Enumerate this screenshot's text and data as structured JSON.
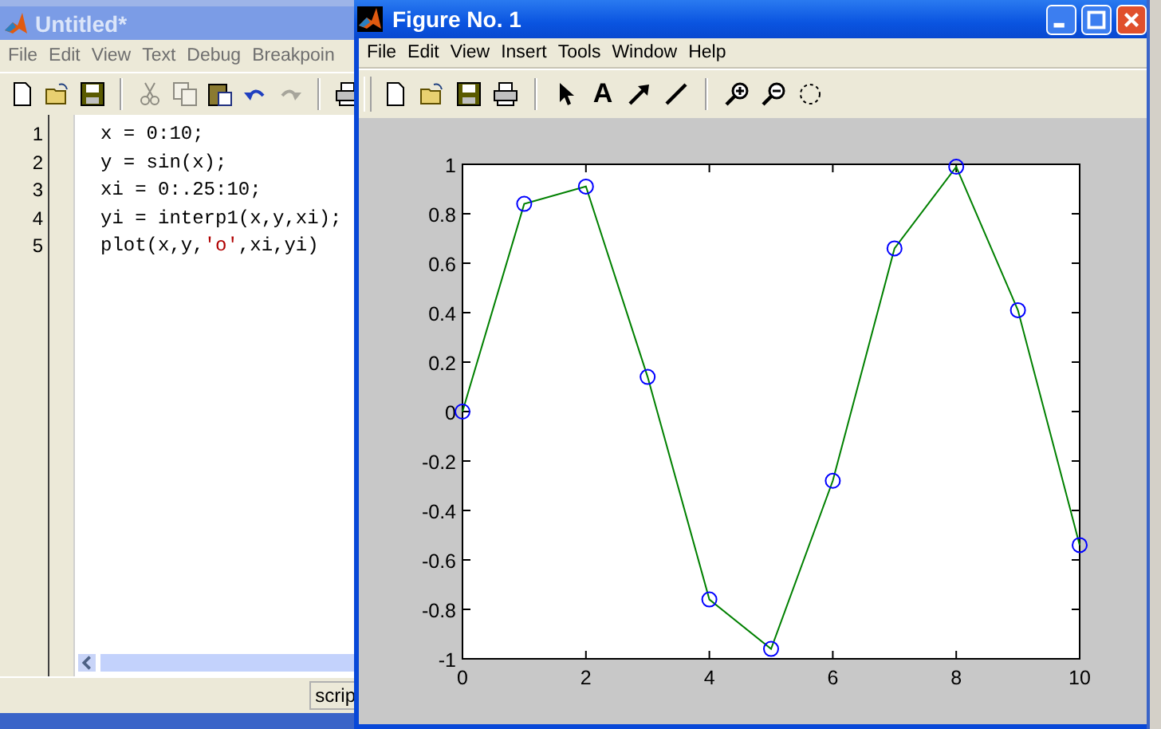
{
  "editor": {
    "title": "Untitled*",
    "menu": [
      "File",
      "Edit",
      "View",
      "Text",
      "Debug",
      "Breakpoin"
    ],
    "toolbar": [
      {
        "kind": "new",
        "disabled": false
      },
      {
        "kind": "open",
        "disabled": false
      },
      {
        "kind": "save",
        "disabled": false
      },
      {
        "kind": "sep"
      },
      {
        "kind": "cut",
        "disabled": true
      },
      {
        "kind": "copy",
        "disabled": true
      },
      {
        "kind": "paste",
        "disabled": false
      },
      {
        "kind": "undo",
        "disabled": false
      },
      {
        "kind": "redo",
        "disabled": true
      },
      {
        "kind": "sep"
      },
      {
        "kind": "print",
        "disabled": false
      }
    ],
    "lines": [
      {
        "number": "1",
        "tokens": [
          {
            "text": "x = 0:10;",
            "kind": "code"
          }
        ]
      },
      {
        "number": "2",
        "tokens": [
          {
            "text": "y = sin(x);",
            "kind": "code"
          }
        ]
      },
      {
        "number": "3",
        "tokens": [
          {
            "text": "xi = 0:.25:10;",
            "kind": "code"
          }
        ]
      },
      {
        "number": "4",
        "tokens": [
          {
            "text": "yi = interp1(x,y,xi);",
            "kind": "code"
          }
        ]
      },
      {
        "number": "5",
        "tokens": [
          {
            "text": "plot(x,y,",
            "kind": "code"
          },
          {
            "text": "'o'",
            "kind": "string"
          },
          {
            "text": ",xi,yi)",
            "kind": "code"
          }
        ]
      }
    ],
    "status": "scrip"
  },
  "figure": {
    "title": "Figure No. 1",
    "menu": [
      "File",
      "Edit",
      "View",
      "Insert",
      "Tools",
      "Window",
      "Help"
    ],
    "toolbar": [
      {
        "kind": "new"
      },
      {
        "kind": "open"
      },
      {
        "kind": "save"
      },
      {
        "kind": "print"
      },
      {
        "kind": "sep"
      },
      {
        "kind": "pointer"
      },
      {
        "kind": "text",
        "label": "A"
      },
      {
        "kind": "arrow"
      },
      {
        "kind": "line"
      },
      {
        "kind": "sep"
      },
      {
        "kind": "zoom-in"
      },
      {
        "kind": "zoom-out"
      },
      {
        "kind": "rotate"
      }
    ],
    "chart_data": {
      "type": "line",
      "x": [
        0,
        1,
        2,
        3,
        4,
        5,
        6,
        7,
        8,
        9,
        10
      ],
      "series": [
        {
          "color": "#008000",
          "marker": "circle",
          "values": [
            0,
            0.84,
            0.91,
            0.14,
            -0.76,
            -0.96,
            -0.28,
            0.66,
            0.99,
            0.41,
            -0.54
          ]
        }
      ],
      "xlim": [
        0,
        10
      ],
      "ylim": [
        -1,
        1
      ],
      "xticks": [
        0,
        2,
        4,
        6,
        8,
        10
      ],
      "yticks": [
        -1,
        -0.8,
        -0.6,
        -0.4,
        -0.2,
        0,
        0.2,
        0.4,
        0.6,
        0.8,
        1
      ]
    }
  }
}
